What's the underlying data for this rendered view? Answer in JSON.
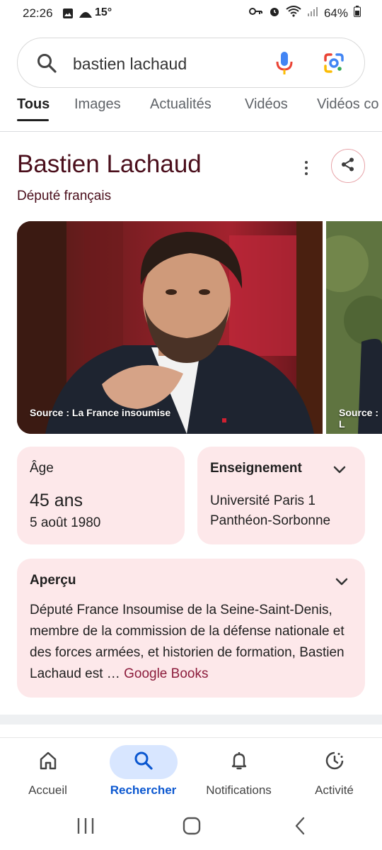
{
  "status_bar": {
    "time": "22:26",
    "temperature": "15°",
    "battery": "64%"
  },
  "search": {
    "query": "bastien lachaud"
  },
  "tabs": [
    {
      "label": "Tous",
      "active": true
    },
    {
      "label": "Images"
    },
    {
      "label": "Actualités"
    },
    {
      "label": "Vidéos"
    },
    {
      "label": "Vidéos co"
    }
  ],
  "knowledge_panel": {
    "title": "Bastien Lachaud",
    "subtitle": "Député français",
    "images": [
      {
        "caption": "Source : La France insoumise"
      },
      {
        "caption": "Source : L"
      }
    ],
    "age": {
      "label": "Âge",
      "value": "45 ans",
      "birth_date": "5 août 1980"
    },
    "education": {
      "label": "Enseignement",
      "value": "Université Paris 1 Panthéon-Sorbonne"
    },
    "overview": {
      "label": "Aperçu",
      "text": "Député France Insoumise de la Seine-Saint-Denis, membre de la commission de la défense nationale et des forces armées, et historien de formation, Bastien Lachaud est …",
      "source": "Google Books"
    }
  },
  "bottom_nav": [
    {
      "label": "Accueil",
      "icon": "home-icon"
    },
    {
      "label": "Rechercher",
      "icon": "search-icon",
      "active": true
    },
    {
      "label": "Notifications",
      "icon": "bell-icon"
    },
    {
      "label": "Activité",
      "icon": "activity-icon"
    }
  ],
  "colors": {
    "title": "#4a0e1b",
    "card_bg": "#fde8ea",
    "accent_blue": "#0b57d0",
    "source_link": "#8c1c3c"
  }
}
